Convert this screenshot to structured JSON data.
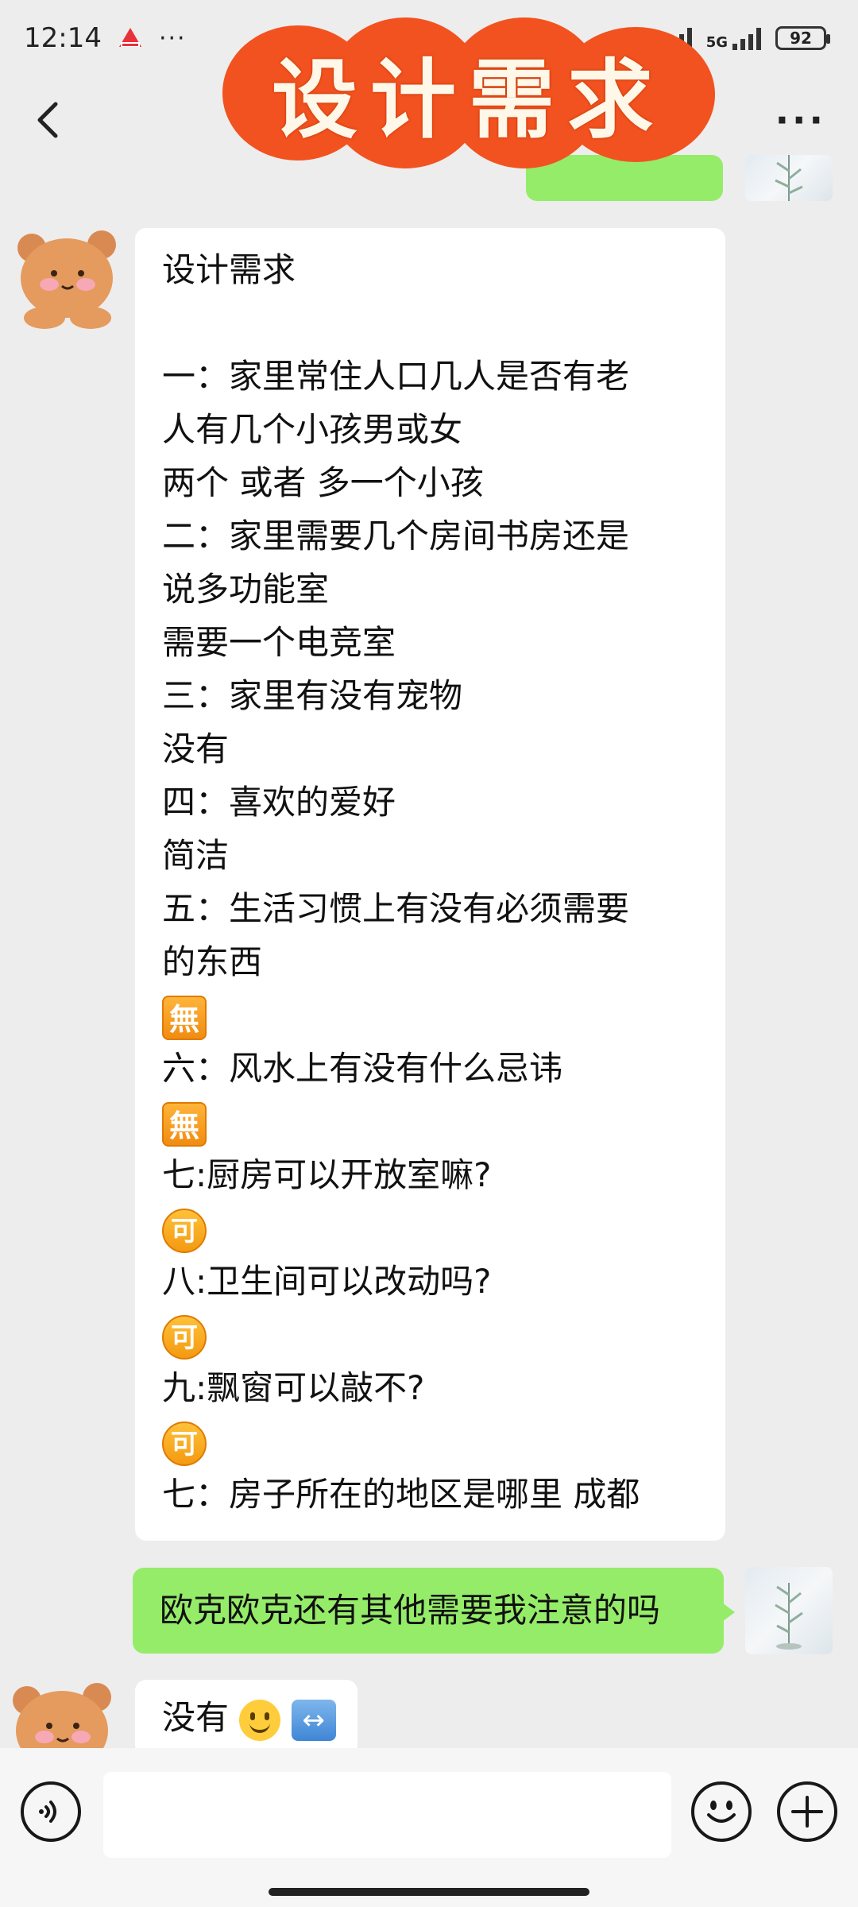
{
  "status_bar": {
    "time": "12:14",
    "more_dots": "···",
    "network": "5G",
    "battery": "92"
  },
  "nav": {
    "more": "···"
  },
  "banner": {
    "title": "设计需求"
  },
  "messages": [
    {
      "side": "left",
      "lines": [
        "设计需求",
        "",
        "一：家里常住人口几人是否有老",
        "人有几个小孩男或女",
        "两个 或者 多一个小孩",
        "二：家里需要几个房间书房还是",
        "说多功能室",
        "需要一个电竞室",
        "三：家里有没有宠物",
        "没有",
        "四：喜欢的爱好",
        "简洁",
        "五：生活习惯上有没有必须需要",
        "的东西",
        "",
        "六：风水上有没有什么忌讳",
        "",
        "七:厨房可以开放室嘛?",
        "",
        "八:卫生间可以改动吗?",
        "",
        "九:飘窗可以敲不?",
        "",
        "七：房子所在的地区是哪里 成都"
      ],
      "emoji_box": "無",
      "emoji_circle": "可"
    },
    {
      "side": "right",
      "text": "欧克欧克还有其他需要我注意的吗"
    },
    {
      "side": "left",
      "text": "没有"
    }
  ],
  "colors": {
    "background": "#ededed",
    "bubble_green": "#95ec69",
    "bubble_white": "#ffffff",
    "banner": "#f2521f"
  }
}
